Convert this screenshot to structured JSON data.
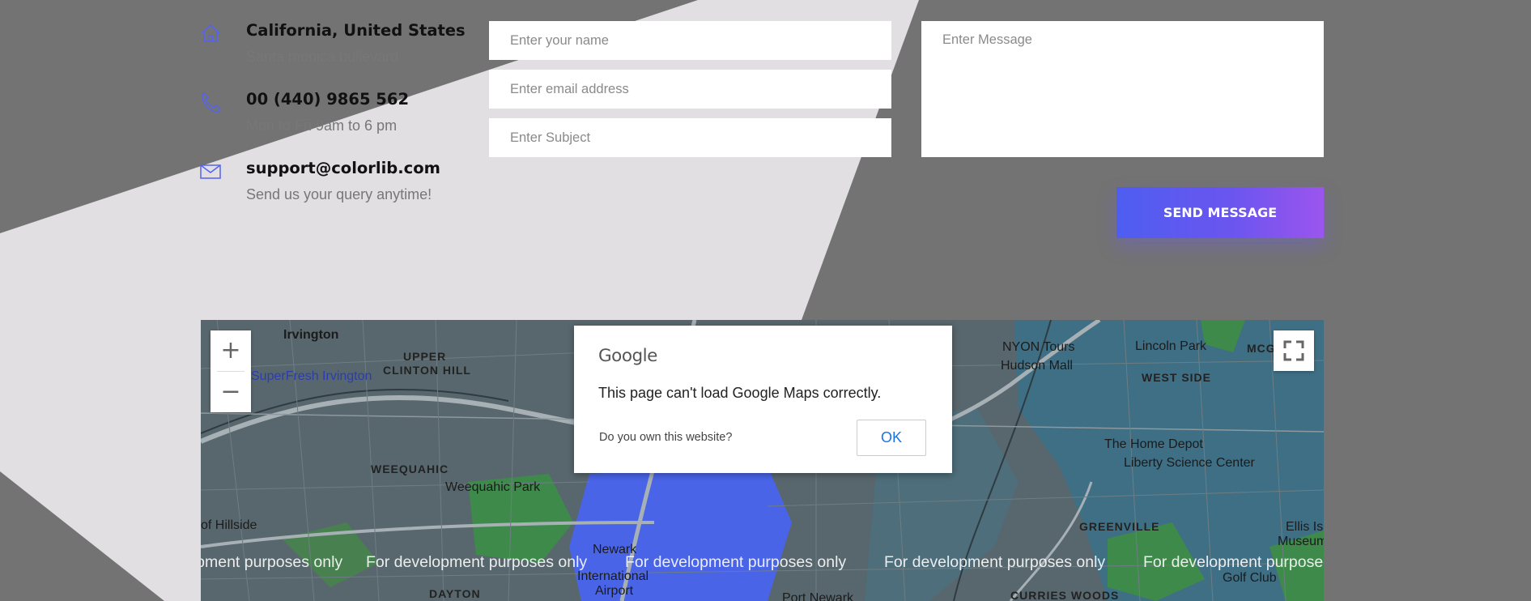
{
  "contact": [
    {
      "icon": "home-icon",
      "title": "California, United States",
      "subtitle": "Santa monica bullevard"
    },
    {
      "icon": "phone-icon",
      "title": "00 (440) 9865 562",
      "subtitle": "Mon to Fri 9am to 6 pm"
    },
    {
      "icon": "mail-icon",
      "title": "support@colorlib.com",
      "subtitle": "Send us your query anytime!"
    }
  ],
  "form": {
    "name_placeholder": "Enter your name",
    "email_placeholder": "Enter email address",
    "subject_placeholder": "Enter Subject",
    "message_placeholder": "Enter Message",
    "send_label": "SEND MESSAGE"
  },
  "map": {
    "zoom_in": "+",
    "zoom_out": "−",
    "watermark": "For development purposes only",
    "labels": {
      "irvington": "Irvington",
      "upper_clinton_hill": "UPPER",
      "upper_clinton_hill_2": "CLINTON HILL",
      "superfresh": "SuperFresh Irvington",
      "weequahic": "WEEQUAHIC",
      "weequahic_park": "Weequahic Park",
      "hillside": "of Hillside",
      "hudson_mall": "Hudson Mall",
      "nyon_tours": "NYON Tours",
      "lincoln_park": "Lincoln Park",
      "west_side": "WEST SIDE",
      "mcginley": "MCGINLEY",
      "home_depot": "The Home Depot",
      "liberty_science": "Liberty Science Center",
      "greenville": "GREENVILLE",
      "dayton": "DAYTON",
      "curries_woods": "CURRIES WOODS",
      "newark": "Newark",
      "international": "International",
      "airport": "Airport",
      "port_newark": "Port Newark",
      "golf_club": "Golf Club",
      "ellis": "Ellis Is",
      "museum": "Museum o"
    },
    "colors": {
      "accent": "#5563f0",
      "water": "#3f6f85",
      "park": "#3e8a4a",
      "airport": "#4a64e8"
    }
  },
  "dialog": {
    "logo": "Google",
    "message": "This page can't load Google Maps correctly.",
    "own_site": "Do you own this website?",
    "ok_label": "OK"
  }
}
